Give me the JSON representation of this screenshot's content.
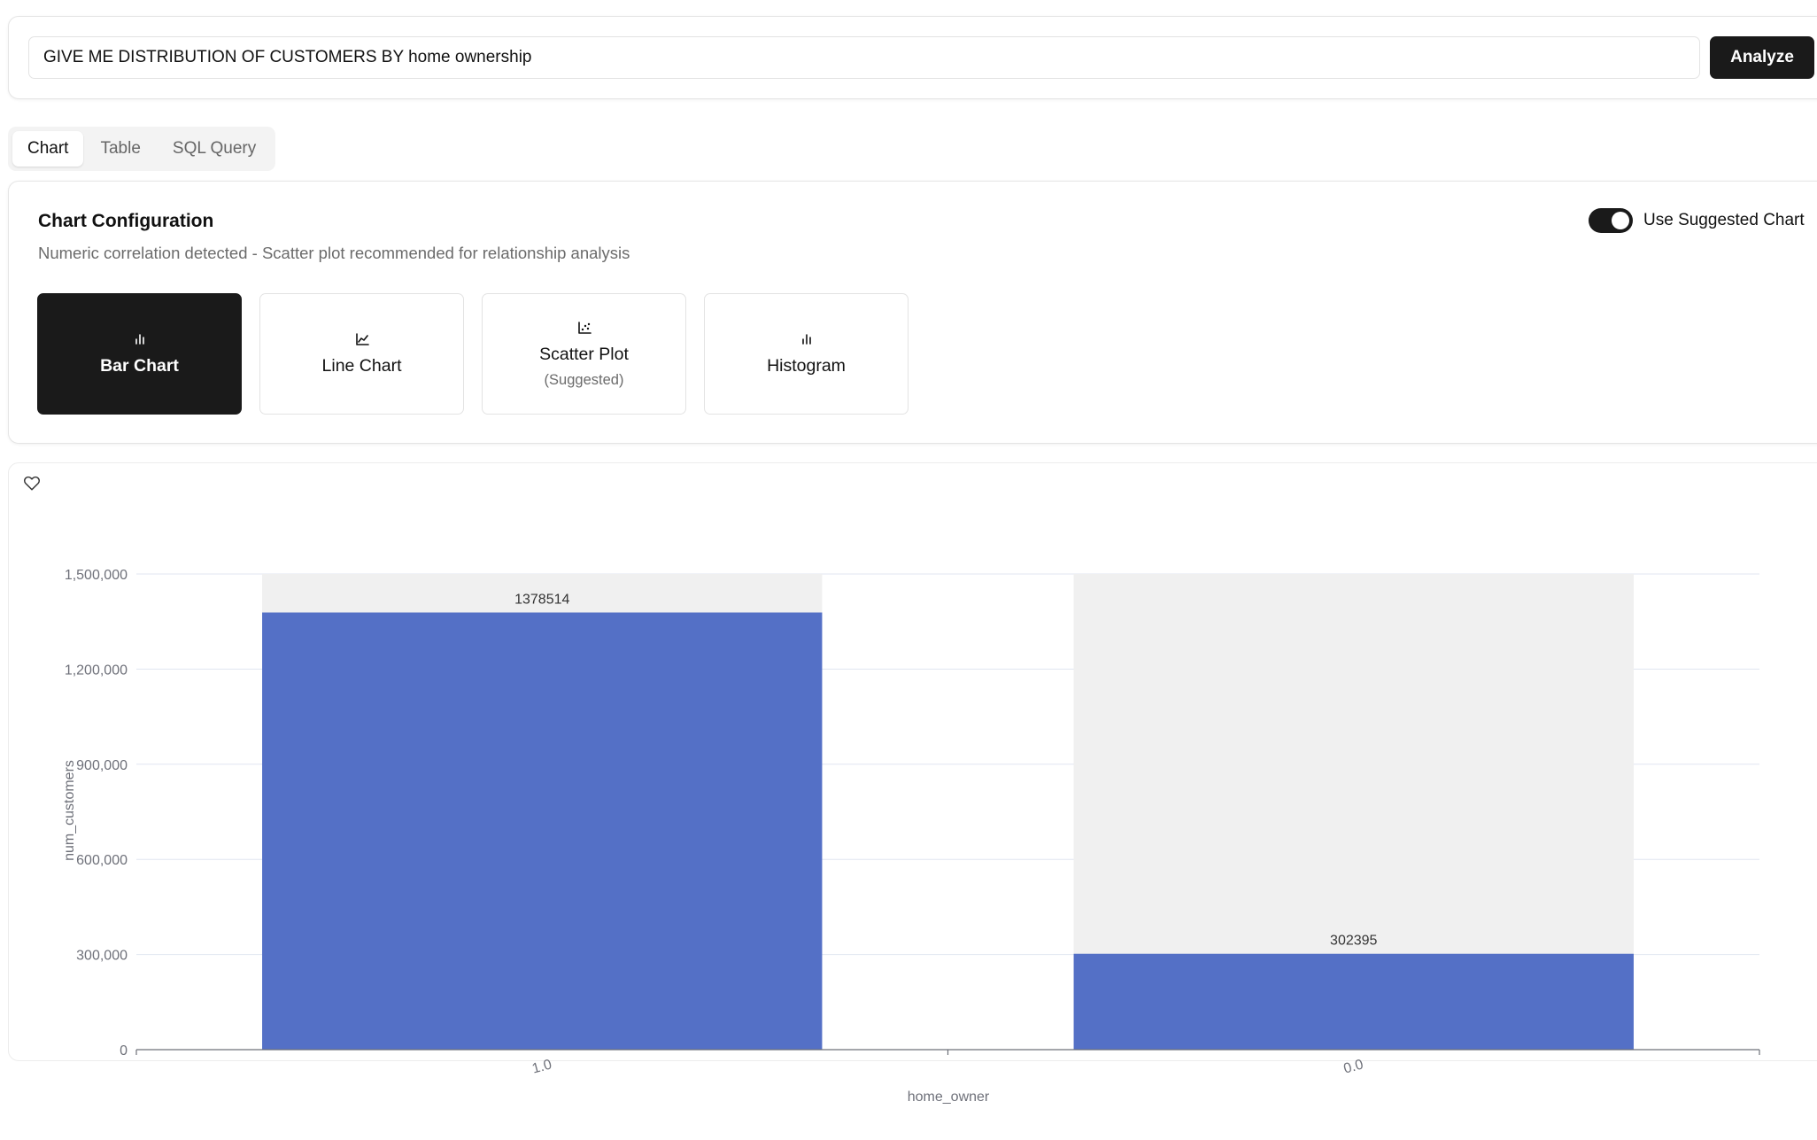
{
  "query": {
    "value": "GIVE ME DISTRIBUTION OF CUSTOMERS BY home ownership",
    "analyze_label": "Analyze"
  },
  "tabs": [
    {
      "label": "Chart",
      "active": true
    },
    {
      "label": "Table",
      "active": false
    },
    {
      "label": "SQL Query",
      "active": false
    }
  ],
  "config": {
    "title": "Chart Configuration",
    "description": "Numeric correlation detected - Scatter plot recommended for relationship analysis",
    "toggle_label": "Use Suggested Chart",
    "toggle_on": true,
    "chart_types": [
      {
        "label": "Bar Chart",
        "icon": "bar-chart-icon",
        "selected": true,
        "sub": ""
      },
      {
        "label": "Line Chart",
        "icon": "line-chart-icon",
        "selected": false,
        "sub": ""
      },
      {
        "label": "Scatter Plot",
        "icon": "scatter-plot-icon",
        "selected": false,
        "sub": "(Suggested)"
      },
      {
        "label": "Histogram",
        "icon": "histogram-icon",
        "selected": false,
        "sub": ""
      }
    ]
  },
  "favorite_icon": "heart-icon",
  "colors": {
    "bar": "#5470c6",
    "bar_background": "#f0f0f0",
    "accent_dark": "#1a1a1a"
  },
  "chart_data": {
    "type": "bar",
    "categories": [
      "1.0",
      "0.0"
    ],
    "values": [
      1378514,
      302395
    ],
    "value_labels": [
      "1378514",
      "302395"
    ],
    "xlabel": "home_owner",
    "ylabel": "num_customers",
    "ylim": [
      0,
      1500000
    ],
    "yticks": [
      0,
      300000,
      600000,
      900000,
      1200000,
      1500000
    ],
    "ytick_labels": [
      "0",
      "300,000",
      "600,000",
      "900,000",
      "1,200,000",
      "1,500,000"
    ],
    "grid": true,
    "show_background": true
  }
}
